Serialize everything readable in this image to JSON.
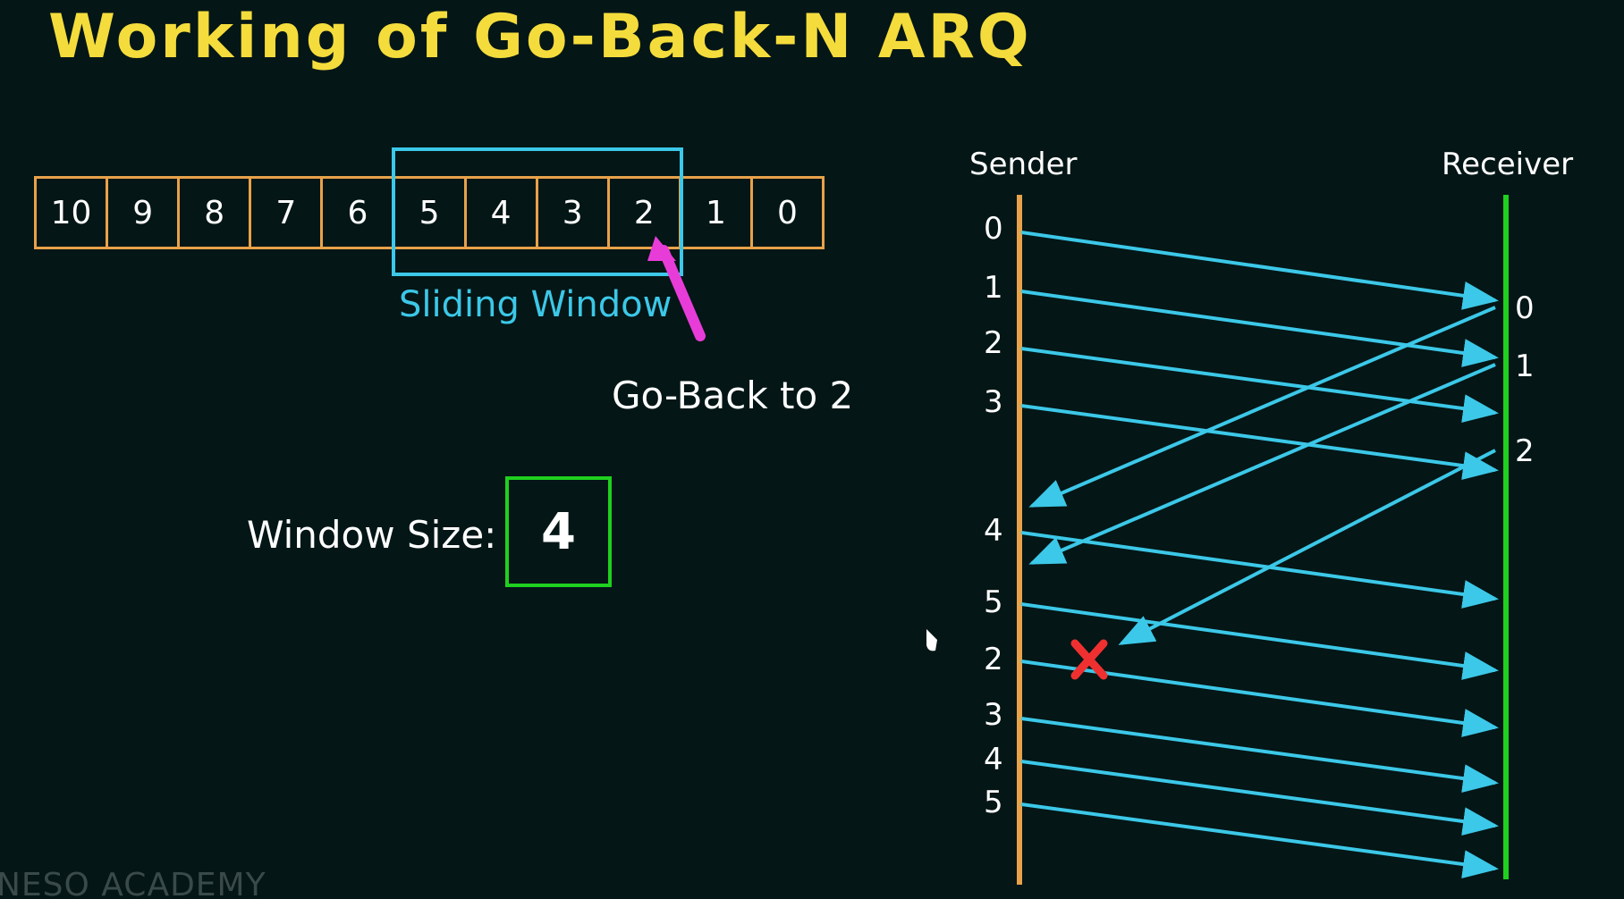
{
  "title": "Working of Go-Back-N ARQ",
  "frames": [
    "10",
    "9",
    "8",
    "7",
    "6",
    "5",
    "4",
    "3",
    "2",
    "1",
    "0"
  ],
  "sliding_window_label": "Sliding Window",
  "go_back_label": "Go-Back to 2",
  "window_size": {
    "label": "Window Size:",
    "value": "4"
  },
  "sender_label": "Sender",
  "receiver_label": "Receiver",
  "sender_sequence": [
    "0",
    "1",
    "2",
    "3",
    "4",
    "5",
    "2",
    "3",
    "4",
    "5"
  ],
  "receiver_sequence": [
    "0",
    "1",
    "2"
  ],
  "watermark": "NESO ACADEMY",
  "colors": {
    "title": "#f4dc3c",
    "frame_border": "#e8a24a",
    "window": "#3cc8e8",
    "pointer": "#e83cd8",
    "window_size_box": "#1fd01f",
    "sender_line": "#e8a24a",
    "receiver_line": "#1fd01f",
    "arrows": "#3cc8e8",
    "lost_mark": "#f03030"
  }
}
